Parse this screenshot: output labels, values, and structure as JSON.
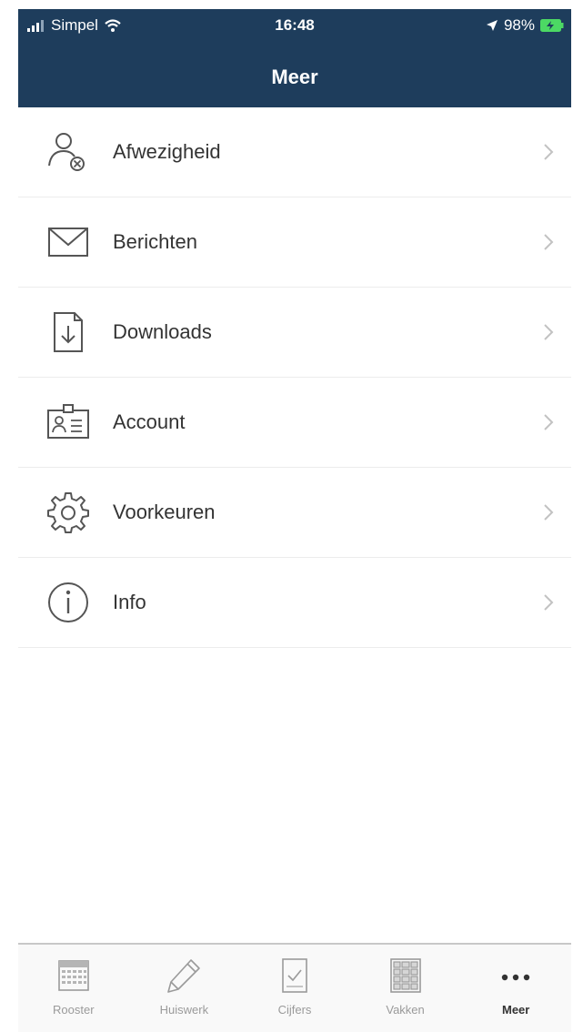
{
  "status_bar": {
    "carrier": "Simpel",
    "time": "16:48",
    "battery": "98%"
  },
  "header": {
    "title": "Meer"
  },
  "menu": {
    "items": [
      {
        "label": "Afwezigheid",
        "icon": "person-absent-icon"
      },
      {
        "label": "Berichten",
        "icon": "envelope-icon"
      },
      {
        "label": "Downloads",
        "icon": "download-file-icon"
      },
      {
        "label": "Account",
        "icon": "id-card-icon"
      },
      {
        "label": "Voorkeuren",
        "icon": "gear-icon"
      },
      {
        "label": "Info",
        "icon": "info-icon"
      }
    ]
  },
  "tab_bar": {
    "tabs": [
      {
        "label": "Rooster",
        "icon": "calendar-icon"
      },
      {
        "label": "Huiswerk",
        "icon": "pencil-icon"
      },
      {
        "label": "Cijfers",
        "icon": "checklist-icon"
      },
      {
        "label": "Vakken",
        "icon": "grid-icon"
      },
      {
        "label": "Meer",
        "icon": "more-dots-icon",
        "active": true
      }
    ]
  },
  "colors": {
    "header_bg": "#1e3d5c",
    "text": "#333333",
    "icon_stroke": "#555555",
    "tab_inactive": "#9a9a9a"
  }
}
